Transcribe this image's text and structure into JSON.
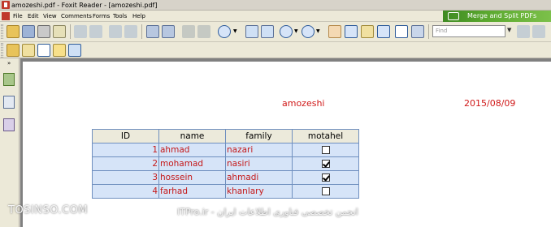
{
  "window": {
    "title": "amozeshi.pdf - Foxit Reader - [amozeshi.pdf]"
  },
  "menu": {
    "items": [
      "File",
      "Edit",
      "View",
      "Comments",
      "Forms",
      "Tools",
      "Help"
    ]
  },
  "banner": {
    "text": "Merge and Split PDFs"
  },
  "search": {
    "placeholder": "Find"
  },
  "document": {
    "header_left": "amozeshi",
    "header_right": "2015/08/09",
    "table": {
      "columns": [
        "ID",
        "name",
        "family",
        "motahel"
      ],
      "rows": [
        {
          "id": "1",
          "name": "ahmad",
          "family": "nazari",
          "motahel": false
        },
        {
          "id": "2",
          "name": "mohamad",
          "family": "nasiri",
          "motahel": true
        },
        {
          "id": "3",
          "name": "hossein",
          "family": "ahmadi",
          "motahel": true
        },
        {
          "id": "4",
          "name": "farhad",
          "family": "khanlary",
          "motahel": false
        }
      ]
    }
  },
  "watermark": {
    "left": "TOSINSO.COM",
    "right": "ITPro.ir - انجمن تخصصی فناوری اطلاعات ایران"
  },
  "colors": {
    "accent_red": "#d01818",
    "table_fill": "#d6e4f8",
    "table_border": "#6f8fbf"
  }
}
